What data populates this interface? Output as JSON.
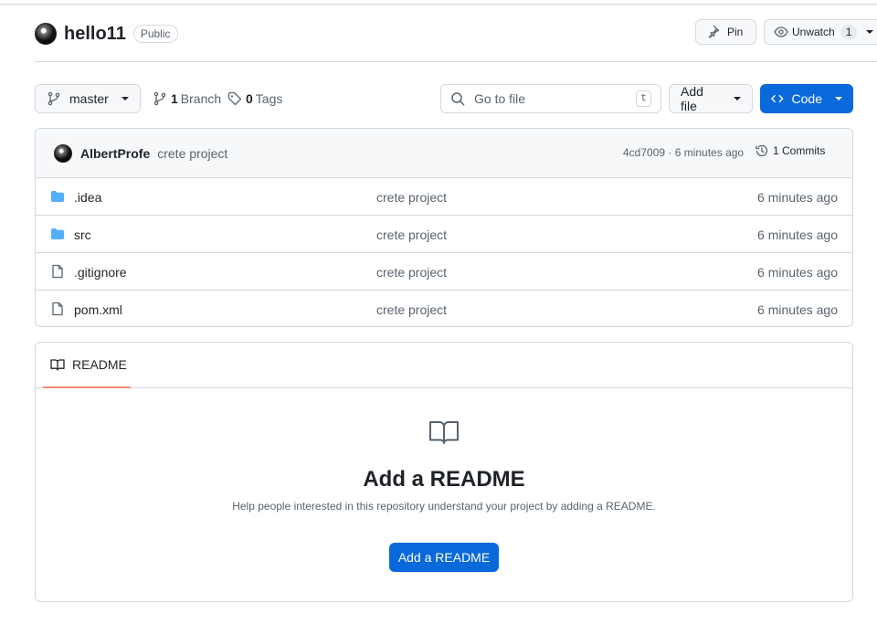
{
  "header": {
    "repo_name": "hello11",
    "visibility": "Public",
    "pin_label": "Pin",
    "watch_label": "Unwatch",
    "watch_count": "1"
  },
  "toolbar": {
    "branch": "master",
    "branch_count": "1",
    "branch_label": "Branch",
    "tag_count": "0",
    "tag_label": "Tags",
    "goto_placeholder": "Go to file",
    "goto_shortcut": "t",
    "add_file_label": "Add file",
    "code_label": "Code"
  },
  "latest_commit": {
    "author": "AlbertProfe",
    "message": "crete project",
    "meta": "4cd7009 · 6 minutes ago",
    "commits_label": "1 Commits"
  },
  "files": [
    {
      "name": ".idea",
      "type": "folder",
      "commit": "crete project",
      "time": "6 minutes ago"
    },
    {
      "name": "src",
      "type": "folder",
      "commit": "crete project",
      "time": "6 minutes ago"
    },
    {
      "name": ".gitignore",
      "type": "file",
      "commit": "crete project",
      "time": "6 minutes ago"
    },
    {
      "name": "pom.xml",
      "type": "file",
      "commit": "crete project",
      "time": "6 minutes ago"
    }
  ],
  "readme": {
    "tab_label": "README",
    "title": "Add a README",
    "description": "Help people interested in this repository understand your project by adding a README.",
    "button_label": "Add a README"
  },
  "colors": {
    "primary": "#0969da",
    "folder": "#54aeff",
    "border": "#d1d9e0",
    "muted_text": "#59636e",
    "tab_underline": "#fd8c73"
  },
  "icons": [
    "pin-icon",
    "eye-icon",
    "branch-icon",
    "tag-icon",
    "search-icon",
    "code-icon",
    "history-icon",
    "folder-icon",
    "file-icon",
    "book-icon"
  ]
}
